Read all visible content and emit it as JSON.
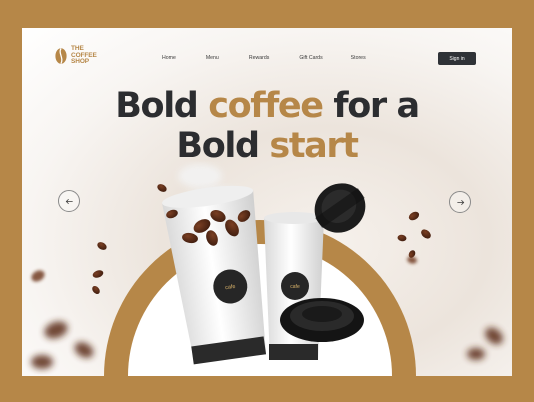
{
  "brand": {
    "name_line1": "THE",
    "name_line2": "COFFEE",
    "name_line3": "SHOP",
    "accent_color": "#b68748",
    "dark_color": "#2c2d30"
  },
  "nav": {
    "items": [
      {
        "label": "Home"
      },
      {
        "label": "Menu"
      },
      {
        "label": "Rewards"
      },
      {
        "label": "Gift Cards"
      },
      {
        "label": "Stores"
      }
    ],
    "signin_label": "Sign in"
  },
  "hero": {
    "line1_prefix": "Bold ",
    "line1_accent": "coffee",
    "line1_suffix": " for a",
    "line2_prefix": "Bold ",
    "line2_accent": "start"
  },
  "cups": {
    "badge_text": "cafe"
  },
  "icons": {
    "prev": "arrow-left-icon",
    "next": "arrow-right-icon"
  }
}
